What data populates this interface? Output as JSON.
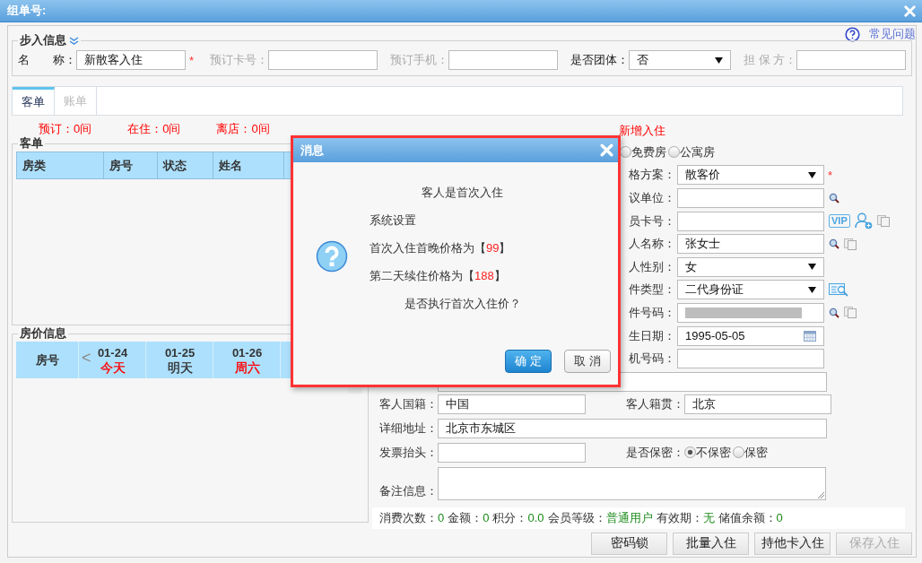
{
  "window": {
    "title": "组单号:"
  },
  "help_link": "常见问题",
  "walkin": {
    "legend": "步入信息",
    "fields": [
      {
        "kind": "text",
        "label": "名　　称：",
        "value": "新散客入住",
        "required": "*",
        "disabled": false
      },
      {
        "kind": "text",
        "label": "预订卡号：",
        "disabled": true
      },
      {
        "kind": "text",
        "label": "预订手机：",
        "disabled": true
      },
      {
        "kind": "select",
        "label": "是否团体：",
        "value": "否",
        "disabled": false
      },
      {
        "kind": "text",
        "label": "担 保 方：",
        "disabled": true
      }
    ]
  },
  "tabs": [
    {
      "label": "客单",
      "selected": true
    },
    {
      "label": "账单",
      "selected": false
    }
  ],
  "counts": [
    "预订：0间",
    "在住：0间",
    "离店：0间"
  ],
  "guest_list": {
    "legend": "客单",
    "columns": [
      "房类",
      "房号",
      "状态",
      "姓名"
    ]
  },
  "room_prices": {
    "legend": "房价信息",
    "room_column": "房号",
    "prev": "<",
    "days": [
      {
        "date": "01-24",
        "label": "今天",
        "color": "#ff0000"
      },
      {
        "date": "01-25",
        "label": "明天",
        "color": "#333333"
      },
      {
        "date": "01-26",
        "label": "周六",
        "color": "#ff0000"
      }
    ]
  },
  "checkin": {
    "title": "新增入住",
    "room_types": [
      {
        "label": "免费房",
        "selected": false
      },
      {
        "label": "公寓房",
        "selected": false
      }
    ],
    "rows": [
      {
        "kind": "select",
        "label": "格方案：",
        "value": "散客价",
        "required": "*"
      },
      {
        "kind": "lookup",
        "label": "议单位："
      },
      {
        "kind": "member",
        "label": "员卡号：",
        "badge": "VIP"
      },
      {
        "kind": "lookup_copy",
        "label": "人名称：",
        "value": "张女士"
      },
      {
        "kind": "select",
        "label": "人性别：",
        "value": "女"
      },
      {
        "kind": "id_select",
        "label": "件类型：",
        "value": "二代身份证"
      },
      {
        "kind": "masked",
        "label": "件号码："
      },
      {
        "kind": "date",
        "label": "生日期：",
        "value": "1995-05-05"
      },
      {
        "kind": "text",
        "label": "机号码："
      }
    ],
    "nationality": {
      "label": "客人国籍：",
      "value": "中国"
    },
    "origin": {
      "label": "客人籍贯：",
      "value": "北京"
    },
    "address": {
      "label": "详细地址：",
      "value": "北京市东城区"
    },
    "invoice": {
      "label": "发票抬头："
    },
    "privacy": {
      "label": "是否保密：",
      "options": [
        {
          "label": "不保密",
          "selected": true
        },
        {
          "label": "保密",
          "selected": false
        }
      ]
    },
    "remarks": {
      "label": "备注信息："
    },
    "stats": [
      {
        "label": "消费次数：",
        "value": "0"
      },
      {
        "label": "金额：",
        "value": "0"
      },
      {
        "label": "积分：",
        "value": "0.0"
      },
      {
        "label": "会员等级：",
        "value": "普通用户"
      },
      {
        "label": "有效期：",
        "value": "无"
      },
      {
        "label": "储值余额：",
        "value": "0"
      }
    ]
  },
  "actions": [
    {
      "label": "密码锁",
      "disabled": false
    },
    {
      "label": "批量入住",
      "disabled": false
    },
    {
      "label": "持他卡入住",
      "disabled": false
    },
    {
      "label": "保存入住",
      "disabled": true
    }
  ],
  "dialog": {
    "title": "消息",
    "lines": [
      {
        "kind": "center",
        "text": "客人是首次入住"
      },
      {
        "kind": "left",
        "text": "系统设置"
      },
      {
        "kind": "price",
        "text": "首次入住首晚价格为【",
        "value": "99",
        "end": "】"
      },
      {
        "kind": "price",
        "text": "第二天续住价格为【",
        "value": "188",
        "end": "】"
      },
      {
        "kind": "center",
        "text": "是否执行首次入住价？"
      }
    ],
    "buttons": [
      {
        "label": "确 定",
        "primary": true
      },
      {
        "label": "取 消",
        "primary": false
      }
    ]
  }
}
